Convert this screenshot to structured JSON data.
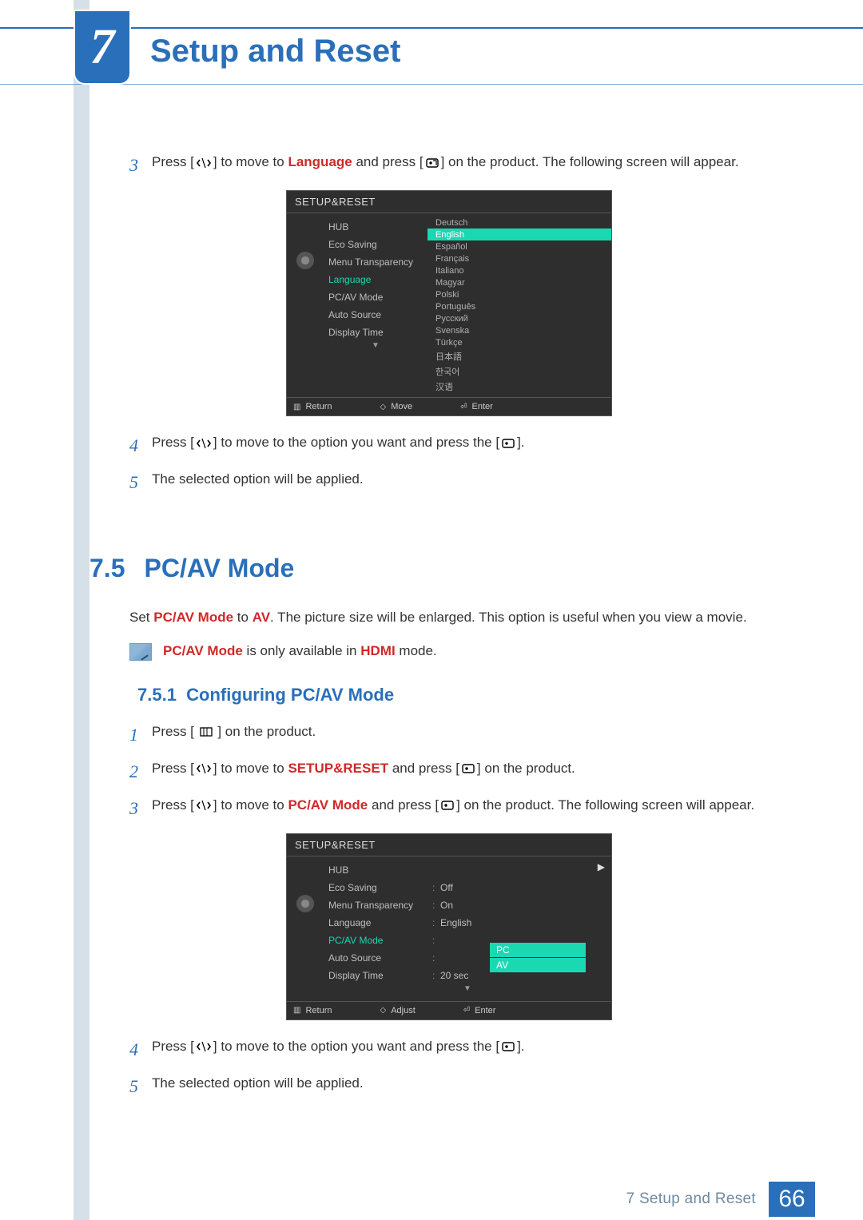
{
  "chapter": {
    "number": "7",
    "title": "Setup and Reset"
  },
  "steps_a": {
    "s3_n": "3",
    "s3_pre": "Press [",
    "s3_mid1": "] to move to ",
    "s3_hl": "Language",
    "s3_mid2": " and press [",
    "s3_post": "] on the product. The following screen will appear.",
    "s4_n": "4",
    "s4_pre": "Press [",
    "s4_mid": "] to move to the option you want and press the [",
    "s4_post": "].",
    "s5_n": "5",
    "s5_txt": "The selected option will be applied."
  },
  "osd1": {
    "title": "SETUP&RESET",
    "menu": [
      "HUB",
      "Eco Saving",
      "Menu Transparency",
      "Language",
      "PC/AV Mode",
      "Auto Source",
      "Display Time"
    ],
    "menu_sel_index": 3,
    "langs": [
      "Deutsch",
      "English",
      "Español",
      "Français",
      "Italiano",
      "Magyar",
      "Polski",
      "Português",
      "Русский",
      "Svenska",
      "Türkçe",
      "日本語",
      "한국어",
      "汉语"
    ],
    "lang_sel_index": 1,
    "footer": {
      "return": "Return",
      "move": "Move",
      "enter": "Enter"
    }
  },
  "section": {
    "num": "7.5",
    "title": "PC/AV Mode"
  },
  "para": {
    "pre": "Set ",
    "hl1": "PC/AV Mode",
    "mid1": " to ",
    "hl2": "AV",
    "post": ". The picture size will be enlarged. This option is useful when you view a movie."
  },
  "note": {
    "hl1": "PC/AV Mode",
    "mid": " is only available in ",
    "hl2": "HDMI",
    "post": " mode."
  },
  "subsection": {
    "num": "7.5.1",
    "title": "Configuring PC/AV Mode"
  },
  "steps_b": {
    "s1_n": "1",
    "s1_pre": "Press [ ",
    "s1_post": " ] on the product.",
    "s2_n": "2",
    "s2_pre": "Press [",
    "s2_mid1": "] to move to ",
    "s2_hl": "SETUP&RESET",
    "s2_mid2": " and press [",
    "s2_post": "] on the product.",
    "s3_n": "3",
    "s3_pre": "Press [",
    "s3_mid1": "] to move to ",
    "s3_hl": "PC/AV Mode",
    "s3_mid2": " and press [",
    "s3_post": "] on the product. The following screen will appear.",
    "s4_n": "4",
    "s4_pre": "Press [",
    "s4_mid": "] to move to the option you want and press the [",
    "s4_post": "].",
    "s5_n": "5",
    "s5_txt": "The selected option will be applied."
  },
  "osd2": {
    "title": "SETUP&RESET",
    "rows": [
      {
        "lab": "HUB",
        "val": ""
      },
      {
        "lab": "Eco Saving",
        "val": "Off"
      },
      {
        "lab": "Menu Transparency",
        "val": "On"
      },
      {
        "lab": "Language",
        "val": "English"
      },
      {
        "lab": "PC/AV Mode",
        "val": ""
      },
      {
        "lab": "Auto Source",
        "val": ""
      },
      {
        "lab": "Display Time",
        "val": "20 sec"
      }
    ],
    "sel_index": 4,
    "opts": [
      "PC",
      "AV"
    ],
    "footer": {
      "return": "Return",
      "adjust": "Adjust",
      "enter": "Enter"
    }
  },
  "footer": {
    "label": "7 Setup and Reset",
    "page": "66"
  }
}
